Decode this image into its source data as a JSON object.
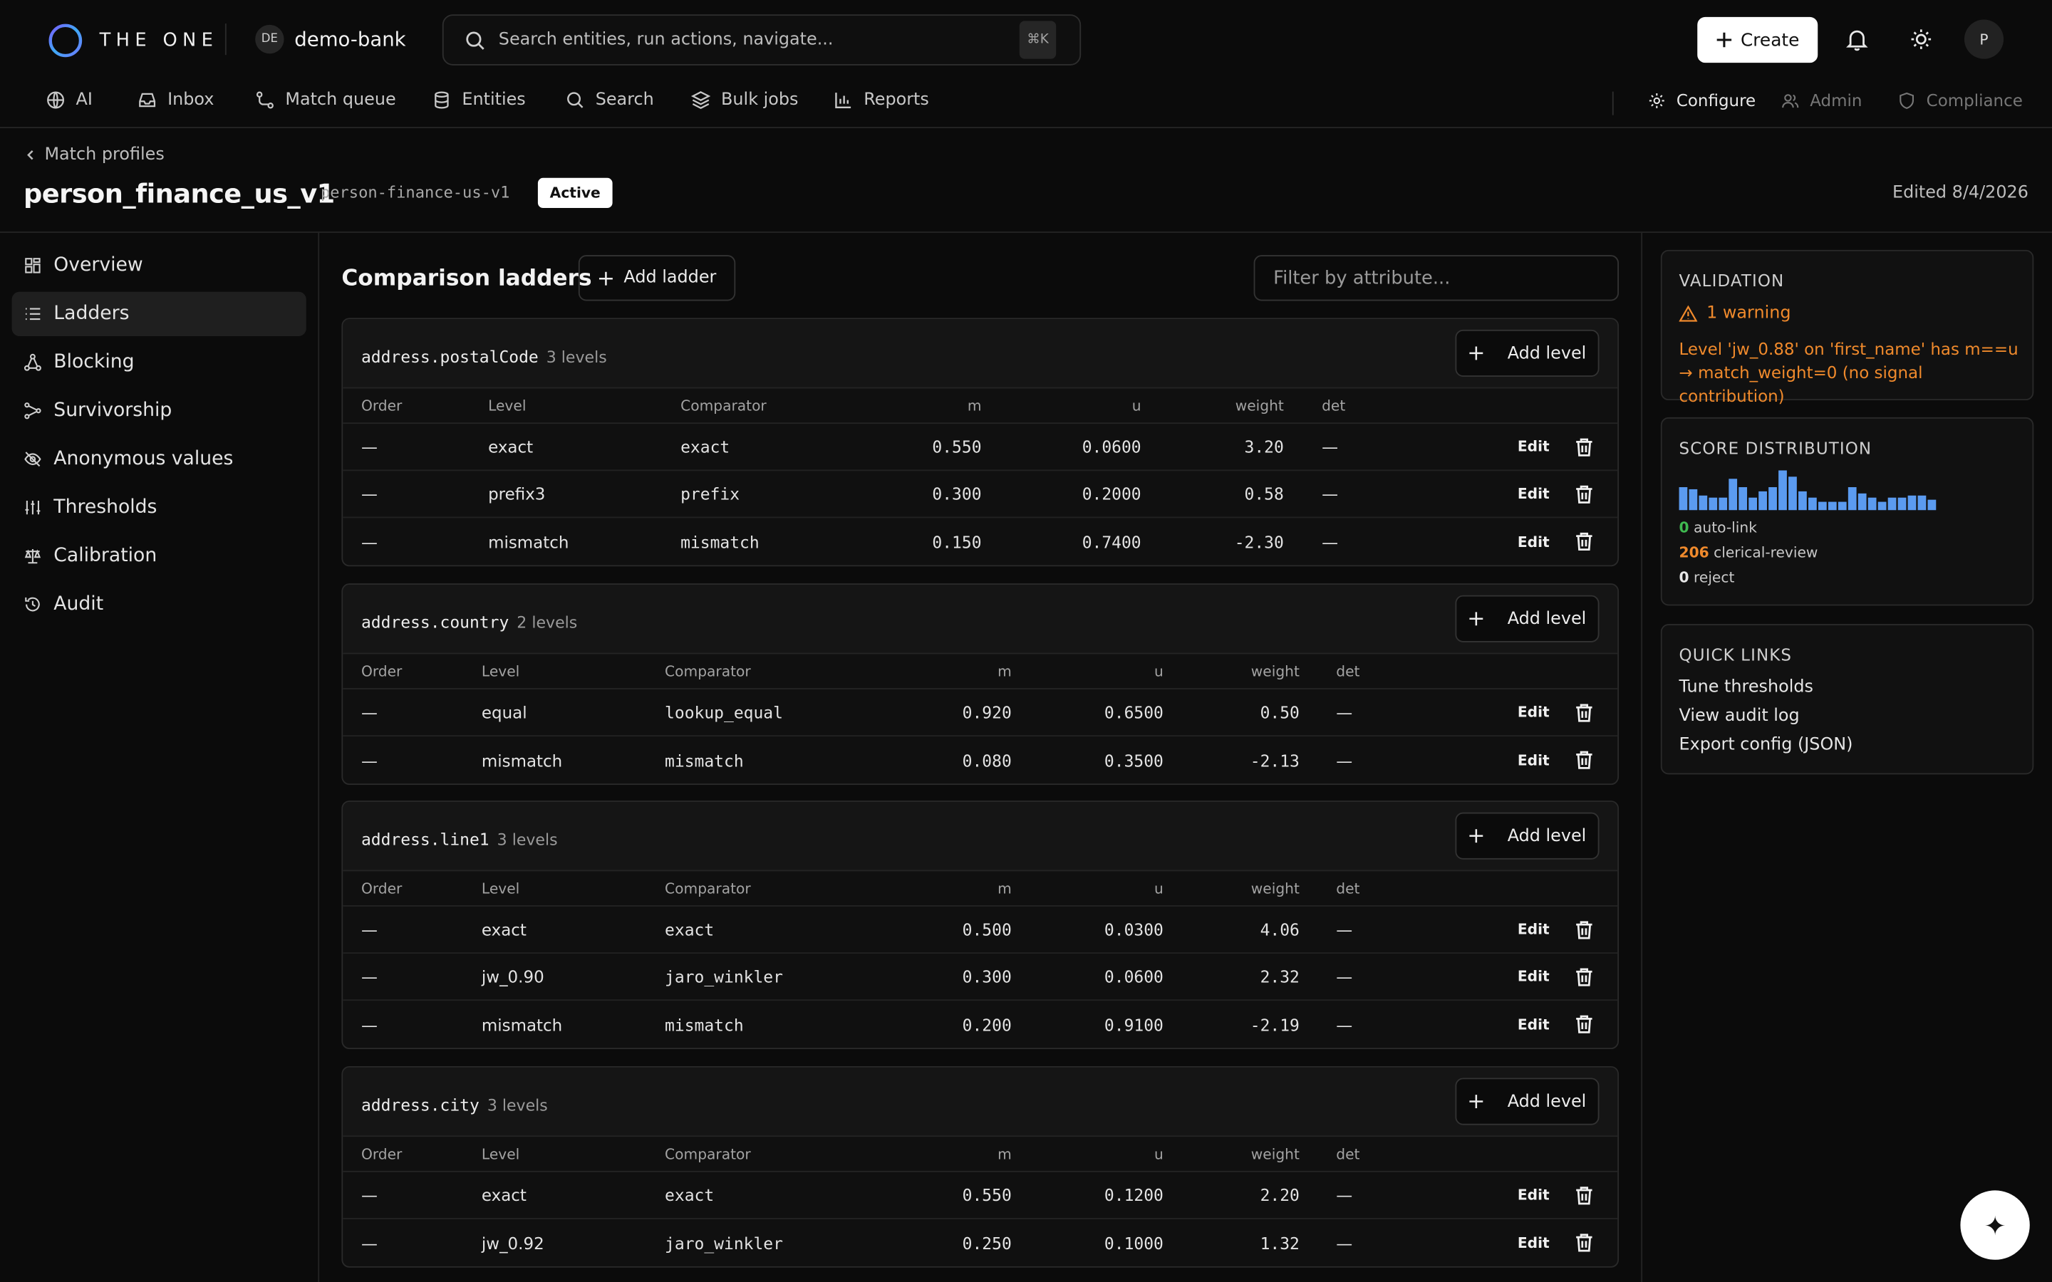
{
  "app": {
    "brand": "THE ONE",
    "tenant_badge": "DE",
    "tenant_name": "demo-bank"
  },
  "search": {
    "placeholder": "Search entities, run actions, navigate...",
    "shortcut": "⌘K"
  },
  "header_actions": {
    "create_label": "Create",
    "avatar_initial": "P"
  },
  "nav": {
    "items": [
      {
        "label": "AI",
        "icon": "globe-icon"
      },
      {
        "label": "Inbox",
        "icon": "inbox-icon"
      },
      {
        "label": "Match queue",
        "icon": "route-icon"
      },
      {
        "label": "Entities",
        "icon": "database-icon"
      },
      {
        "label": "Search",
        "icon": "search-icon"
      },
      {
        "label": "Bulk jobs",
        "icon": "layers-icon"
      },
      {
        "label": "Reports",
        "icon": "bar-chart-icon"
      }
    ],
    "right": [
      {
        "label": "Configure",
        "icon": "gear-icon"
      },
      {
        "label": "Admin",
        "icon": "users-icon"
      },
      {
        "label": "Compliance",
        "icon": "shield-icon"
      }
    ]
  },
  "page": {
    "back_label": "Match profiles",
    "title": "person_finance_us_v1",
    "slug": "person-finance-us-v1",
    "status": "Active",
    "edited": "Edited 8/4/2026"
  },
  "sidebar": {
    "items": [
      {
        "label": "Overview",
        "icon": "grid-icon"
      },
      {
        "label": "Ladders",
        "icon": "list-icon"
      },
      {
        "label": "Blocking",
        "icon": "network-icon"
      },
      {
        "label": "Survivorship",
        "icon": "merge-icon"
      },
      {
        "label": "Anonymous values",
        "icon": "eye-off-icon"
      },
      {
        "label": "Thresholds",
        "icon": "sliders-icon"
      },
      {
        "label": "Calibration",
        "icon": "scale-icon"
      },
      {
        "label": "Audit",
        "icon": "history-icon"
      }
    ]
  },
  "main": {
    "title": "Comparison ladders",
    "add_ladder_label": "Add ladder",
    "filter_placeholder": "Filter by attribute...",
    "add_level_label": "Add level",
    "edit_label": "Edit",
    "columns": [
      "Order",
      "Level",
      "Comparator",
      "m",
      "u",
      "weight",
      "det"
    ],
    "ladders": [
      {
        "attribute": "address.postalCode",
        "count": "3 levels",
        "rows": [
          {
            "order": "—",
            "level": "exact",
            "comparator": "exact",
            "m": "0.550",
            "u": "0.0600",
            "weight": "3.20",
            "det": "—"
          },
          {
            "order": "—",
            "level": "prefix3",
            "comparator": "prefix",
            "m": "0.300",
            "u": "0.2000",
            "weight": "0.58",
            "det": "—"
          },
          {
            "order": "—",
            "level": "mismatch",
            "comparator": "mismatch",
            "m": "0.150",
            "u": "0.7400",
            "weight": "-2.30",
            "det": "—"
          }
        ]
      },
      {
        "attribute": "address.country",
        "count": "2 levels",
        "rows": [
          {
            "order": "—",
            "level": "equal",
            "comparator": "lookup_equal",
            "m": "0.920",
            "u": "0.6500",
            "weight": "0.50",
            "det": "—"
          },
          {
            "order": "—",
            "level": "mismatch",
            "comparator": "mismatch",
            "m": "0.080",
            "u": "0.3500",
            "weight": "-2.13",
            "det": "—"
          }
        ]
      },
      {
        "attribute": "address.line1",
        "count": "3 levels",
        "rows": [
          {
            "order": "—",
            "level": "exact",
            "comparator": "exact",
            "m": "0.500",
            "u": "0.0300",
            "weight": "4.06",
            "det": "—"
          },
          {
            "order": "—",
            "level": "jw_0.90",
            "comparator": "jaro_winkler",
            "m": "0.300",
            "u": "0.0600",
            "weight": "2.32",
            "det": "—"
          },
          {
            "order": "—",
            "level": "mismatch",
            "comparator": "mismatch",
            "m": "0.200",
            "u": "0.9100",
            "weight": "-2.19",
            "det": "—"
          }
        ]
      },
      {
        "attribute": "address.city",
        "count": "3 levels",
        "rows": [
          {
            "order": "—",
            "level": "exact",
            "comparator": "exact",
            "m": "0.550",
            "u": "0.1200",
            "weight": "2.20",
            "det": "—"
          },
          {
            "order": "—",
            "level": "jw_0.92",
            "comparator": "jaro_winkler",
            "m": "0.250",
            "u": "0.1000",
            "weight": "1.32",
            "det": "—"
          }
        ]
      }
    ]
  },
  "validation": {
    "title": "VALIDATION",
    "summary": "1 warning",
    "message": "Level 'jw_0.88' on 'first_name' has m==u → match_weight=0 (no signal contribution)",
    "color": "#f08a2c"
  },
  "score_distribution": {
    "title": "SCORE DISTRIBUTION",
    "bar_color": "#5b9bf0",
    "histogram": [
      0.55,
      0.5,
      0.35,
      0.3,
      0.3,
      0.75,
      0.55,
      0.3,
      0.45,
      0.55,
      0.95,
      0.8,
      0.45,
      0.3,
      0.2,
      0.2,
      0.2,
      0.55,
      0.4,
      0.3,
      0.2,
      0.3,
      0.3,
      0.35,
      0.35,
      0.25
    ],
    "legend": [
      {
        "count": "0",
        "label": "auto-link",
        "color": "#3fb950"
      },
      {
        "count": "206",
        "label": "clerical-review",
        "color": "#f08a2c"
      },
      {
        "count": "0",
        "label": "reject",
        "color": "#e6e6e6"
      }
    ]
  },
  "quick_links": {
    "title": "QUICK LINKS",
    "items": [
      "Tune thresholds",
      "View audit log",
      "Export config (JSON)"
    ]
  },
  "fab_glyph": "✦"
}
